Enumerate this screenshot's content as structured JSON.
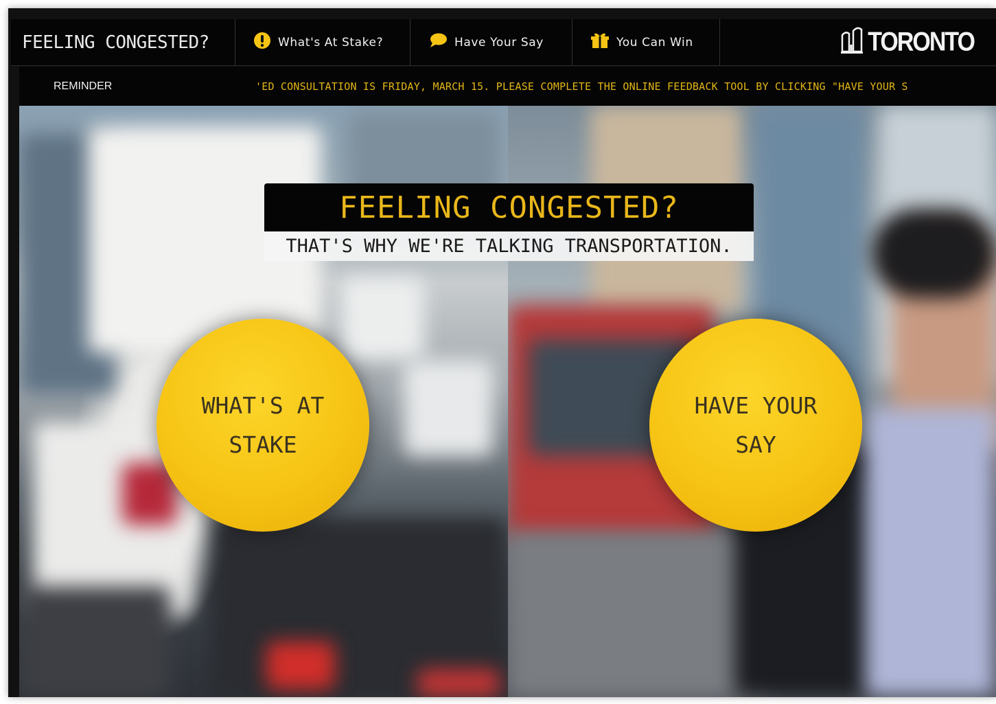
{
  "nav": {
    "brand": "FEELING CONGESTED?",
    "items": [
      {
        "label": "What's At Stake?",
        "icon": "exclamation-icon"
      },
      {
        "label": "Have Your Say",
        "icon": "speech-bubble-icon"
      },
      {
        "label": "You Can Win",
        "icon": "gift-icon"
      }
    ],
    "logo": "TORONTO",
    "accent": "#f6c414"
  },
  "reminder": {
    "label": "REMINDER",
    "ticker": "'ED CONSULTATION IS FRIDAY, MARCH 15. PLEASE COMPLETE THE ONLINE FEEDBACK TOOL BY CLICKING \"HAVE YOUR S"
  },
  "hero": {
    "headline": "FEELING CONGESTED?",
    "subheadline": "THAT'S WHY WE'RE TALKING TRANSPORTATION.",
    "buttons": [
      {
        "label": "WHAT'S AT STAKE"
      },
      {
        "label": "HAVE YOUR SAY"
      }
    ]
  }
}
